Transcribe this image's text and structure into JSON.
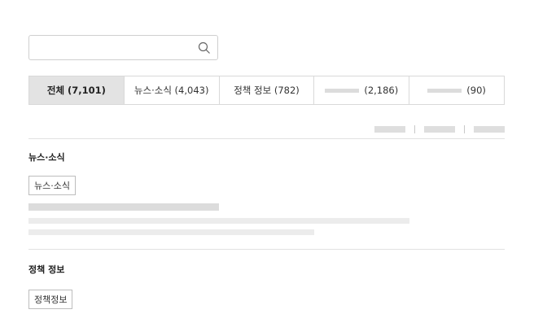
{
  "search": {
    "value": "",
    "placeholder": ""
  },
  "tabs": [
    {
      "label": "전체 (7,101)"
    },
    {
      "label": "뉴스·소식 (4,043)"
    },
    {
      "label": "정책 정보 (782)"
    },
    {
      "label": "(2,186)"
    },
    {
      "label": "(90)"
    }
  ],
  "sections": [
    {
      "title": "뉴스·소식",
      "chip": "뉴스·소식"
    },
    {
      "title": "정책 정보",
      "chip": "정책정보"
    }
  ],
  "icons": {
    "search": "search-icon"
  },
  "colors": {
    "active_tab_bg": "#e3e3e3",
    "border": "#d9d9d9",
    "skeleton": "#e6e6e6"
  }
}
